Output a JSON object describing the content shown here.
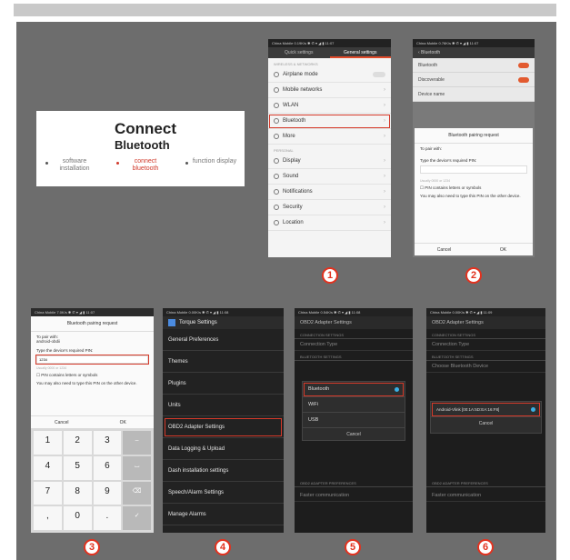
{
  "card": {
    "title_line1": "Connect",
    "title_line2": "Bluetooth",
    "steps": [
      {
        "label": "software installation",
        "active": false
      },
      {
        "label": "connect bluetooth",
        "active": true
      },
      {
        "label": "function display",
        "active": false
      }
    ]
  },
  "step_numbers": [
    "1",
    "2",
    "3",
    "4",
    "5",
    "6"
  ],
  "phone1": {
    "status": "China Mobile   0.19K/s  ✱ ✆ ▾ ◢ ▮ 11:07",
    "tabs": [
      "Quick settings",
      "General settings"
    ],
    "section1": "WIRELESS & NETWORKS",
    "items_top": [
      {
        "label": "Airplane mode",
        "toggle": true
      },
      {
        "label": "Mobile networks"
      },
      {
        "label": "WLAN"
      },
      {
        "label": "Bluetooth",
        "highlight": true
      },
      {
        "label": "More"
      }
    ],
    "section2": "PERSONAL",
    "items_bottom": [
      {
        "label": "Display"
      },
      {
        "label": "Sound"
      },
      {
        "label": "Notifications"
      },
      {
        "label": "Security"
      },
      {
        "label": "Location"
      }
    ]
  },
  "phone2": {
    "status": "China Mobile   0.76K/s  ✱ ✆ ▾ ◢ ▮ 11:07",
    "header": "‹ Bluetooth",
    "rows": [
      "Bluetooth",
      "Discoverable",
      "Device name"
    ],
    "dialog": {
      "title": "Bluetooth pairing request",
      "line1": "To pair with:",
      "line2": "Type the device's required PIN:",
      "hint": "Usually 0000 or 1234",
      "checkbox": "PIN contains letters or symbols",
      "note": "You may also need to type this PIN on the other device.",
      "cancel": "Cancel",
      "ok": "OK"
    }
  },
  "phone3": {
    "status": "China Mobile   7.0K/s  ✱ ✆ ▾ ◢ ▮ 11:07",
    "title": "Bluetooth pairing request",
    "pair_with": "To pair with:",
    "device": "android-obdii",
    "prompt": "Type the device's required PIN:",
    "pin": "1234",
    "hint": "Usually 0000 or 1234",
    "checkbox": "PIN contains letters or symbols",
    "note": "You may also need to type this PIN on the other device.",
    "cancel": "Cancel",
    "ok": "OK",
    "keys": [
      "1",
      "2",
      "3",
      "–",
      "4",
      "5",
      "6",
      "⌴",
      "7",
      "8",
      "9",
      "⌫",
      ",",
      "0",
      ".",
      "✓"
    ]
  },
  "phone4": {
    "status": "China Mobile   0.00K/s  ✱ ✆ ▾ ◢ ▮ 11:08",
    "title": "Torque Settings",
    "items": [
      {
        "label": "General Preferences"
      },
      {
        "label": "Themes"
      },
      {
        "label": "Plugins"
      },
      {
        "label": "Units"
      },
      {
        "label": "OBD2 Adapter Settings",
        "highlight": true
      },
      {
        "label": "Data Logging & Upload"
      },
      {
        "label": "Dash installation settings"
      },
      {
        "label": "Speech/Alarm Settings"
      },
      {
        "label": "Manage Alarms"
      }
    ]
  },
  "phone5": {
    "status": "China Mobile   0.54K/s  ✱ ✆ ▾ ◢ ▮ 11:08",
    "title": "OBD2 Adapter Settings",
    "section": "CONNECTION SETTINGS",
    "pref_title": "Connection Type",
    "section2": "BLUETOOTH SETTINGS",
    "options": [
      "Bluetooth",
      "WiFi",
      "USB"
    ],
    "cancel": "Cancel",
    "section3": "OBD2 ADAPTER PREFERENCES",
    "pref2": "Faster communication"
  },
  "phone6": {
    "status": "China Mobile   0.00K/s  ✱ ✆ ▾ ◢ ▮ 11:09",
    "title": "OBD2 Adapter Settings",
    "section": "CONNECTION SETTINGS",
    "pref_title": "Connection Type",
    "section2": "BLUETOOTH SETTINGS",
    "pref_device": "Choose Bluetooth Device",
    "device": "Android-Vlink [00:1A:5D:EA:16:F8]",
    "cancel": "Cancel",
    "section3": "OBD2 ADAPTER PREFERENCES",
    "pref2": "Faster communication"
  },
  "colors": {
    "accent": "#d63a2a",
    "panel": "#6d6d6d"
  }
}
